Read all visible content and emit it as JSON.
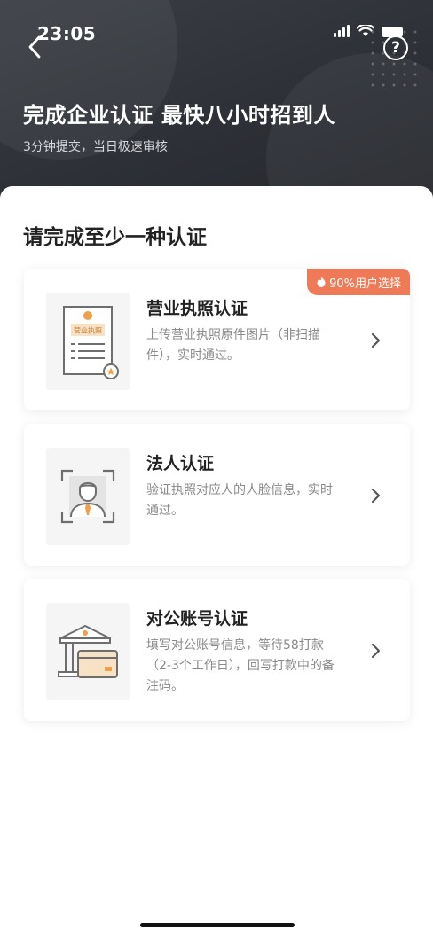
{
  "status_bar": {
    "time": "23:05"
  },
  "header": {
    "title": "完成企业认证  最快八小时招到人",
    "subtitle": "3分钟提交，当日极速审核",
    "help_label": "?"
  },
  "section_title": "请完成至少一种认证",
  "cards": [
    {
      "title": "营业执照认证",
      "desc": "上传营业执照原件图片（非扫描件），实时通过。",
      "badge": "90%用户选择",
      "icon_text": "营业执照"
    },
    {
      "title": "法人认证",
      "desc": "验证执照对应人的人脸信息，实时通过。"
    },
    {
      "title": "对公账号认证",
      "desc": "填写对公账号信息，等待58打款（2-3个工作日），回写打款中的备注码。"
    }
  ],
  "colors": {
    "accent": "#ef7a57",
    "header_bg": "#2f3238",
    "icon_orange": "#f0a04b"
  }
}
